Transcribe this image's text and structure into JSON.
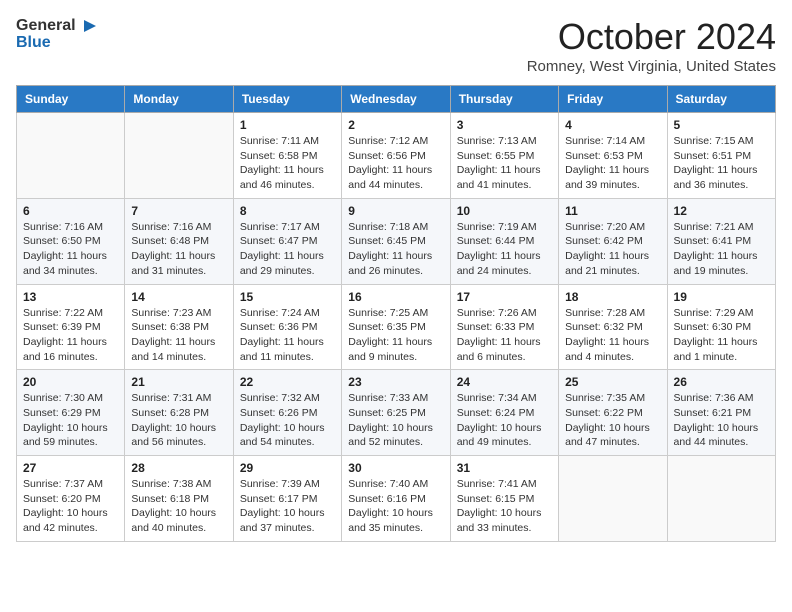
{
  "header": {
    "logo_general": "General",
    "logo_blue": "Blue",
    "month_title": "October 2024",
    "location": "Romney, West Virginia, United States"
  },
  "days_of_week": [
    "Sunday",
    "Monday",
    "Tuesday",
    "Wednesday",
    "Thursday",
    "Friday",
    "Saturday"
  ],
  "weeks": [
    [
      {
        "day": "",
        "info": ""
      },
      {
        "day": "",
        "info": ""
      },
      {
        "day": "1",
        "info": "Sunrise: 7:11 AM\nSunset: 6:58 PM\nDaylight: 11 hours and 46 minutes."
      },
      {
        "day": "2",
        "info": "Sunrise: 7:12 AM\nSunset: 6:56 PM\nDaylight: 11 hours and 44 minutes."
      },
      {
        "day": "3",
        "info": "Sunrise: 7:13 AM\nSunset: 6:55 PM\nDaylight: 11 hours and 41 minutes."
      },
      {
        "day": "4",
        "info": "Sunrise: 7:14 AM\nSunset: 6:53 PM\nDaylight: 11 hours and 39 minutes."
      },
      {
        "day": "5",
        "info": "Sunrise: 7:15 AM\nSunset: 6:51 PM\nDaylight: 11 hours and 36 minutes."
      }
    ],
    [
      {
        "day": "6",
        "info": "Sunrise: 7:16 AM\nSunset: 6:50 PM\nDaylight: 11 hours and 34 minutes."
      },
      {
        "day": "7",
        "info": "Sunrise: 7:16 AM\nSunset: 6:48 PM\nDaylight: 11 hours and 31 minutes."
      },
      {
        "day": "8",
        "info": "Sunrise: 7:17 AM\nSunset: 6:47 PM\nDaylight: 11 hours and 29 minutes."
      },
      {
        "day": "9",
        "info": "Sunrise: 7:18 AM\nSunset: 6:45 PM\nDaylight: 11 hours and 26 minutes."
      },
      {
        "day": "10",
        "info": "Sunrise: 7:19 AM\nSunset: 6:44 PM\nDaylight: 11 hours and 24 minutes."
      },
      {
        "day": "11",
        "info": "Sunrise: 7:20 AM\nSunset: 6:42 PM\nDaylight: 11 hours and 21 minutes."
      },
      {
        "day": "12",
        "info": "Sunrise: 7:21 AM\nSunset: 6:41 PM\nDaylight: 11 hours and 19 minutes."
      }
    ],
    [
      {
        "day": "13",
        "info": "Sunrise: 7:22 AM\nSunset: 6:39 PM\nDaylight: 11 hours and 16 minutes."
      },
      {
        "day": "14",
        "info": "Sunrise: 7:23 AM\nSunset: 6:38 PM\nDaylight: 11 hours and 14 minutes."
      },
      {
        "day": "15",
        "info": "Sunrise: 7:24 AM\nSunset: 6:36 PM\nDaylight: 11 hours and 11 minutes."
      },
      {
        "day": "16",
        "info": "Sunrise: 7:25 AM\nSunset: 6:35 PM\nDaylight: 11 hours and 9 minutes."
      },
      {
        "day": "17",
        "info": "Sunrise: 7:26 AM\nSunset: 6:33 PM\nDaylight: 11 hours and 6 minutes."
      },
      {
        "day": "18",
        "info": "Sunrise: 7:28 AM\nSunset: 6:32 PM\nDaylight: 11 hours and 4 minutes."
      },
      {
        "day": "19",
        "info": "Sunrise: 7:29 AM\nSunset: 6:30 PM\nDaylight: 11 hours and 1 minute."
      }
    ],
    [
      {
        "day": "20",
        "info": "Sunrise: 7:30 AM\nSunset: 6:29 PM\nDaylight: 10 hours and 59 minutes."
      },
      {
        "day": "21",
        "info": "Sunrise: 7:31 AM\nSunset: 6:28 PM\nDaylight: 10 hours and 56 minutes."
      },
      {
        "day": "22",
        "info": "Sunrise: 7:32 AM\nSunset: 6:26 PM\nDaylight: 10 hours and 54 minutes."
      },
      {
        "day": "23",
        "info": "Sunrise: 7:33 AM\nSunset: 6:25 PM\nDaylight: 10 hours and 52 minutes."
      },
      {
        "day": "24",
        "info": "Sunrise: 7:34 AM\nSunset: 6:24 PM\nDaylight: 10 hours and 49 minutes."
      },
      {
        "day": "25",
        "info": "Sunrise: 7:35 AM\nSunset: 6:22 PM\nDaylight: 10 hours and 47 minutes."
      },
      {
        "day": "26",
        "info": "Sunrise: 7:36 AM\nSunset: 6:21 PM\nDaylight: 10 hours and 44 minutes."
      }
    ],
    [
      {
        "day": "27",
        "info": "Sunrise: 7:37 AM\nSunset: 6:20 PM\nDaylight: 10 hours and 42 minutes."
      },
      {
        "day": "28",
        "info": "Sunrise: 7:38 AM\nSunset: 6:18 PM\nDaylight: 10 hours and 40 minutes."
      },
      {
        "day": "29",
        "info": "Sunrise: 7:39 AM\nSunset: 6:17 PM\nDaylight: 10 hours and 37 minutes."
      },
      {
        "day": "30",
        "info": "Sunrise: 7:40 AM\nSunset: 6:16 PM\nDaylight: 10 hours and 35 minutes."
      },
      {
        "day": "31",
        "info": "Sunrise: 7:41 AM\nSunset: 6:15 PM\nDaylight: 10 hours and 33 minutes."
      },
      {
        "day": "",
        "info": ""
      },
      {
        "day": "",
        "info": ""
      }
    ]
  ]
}
